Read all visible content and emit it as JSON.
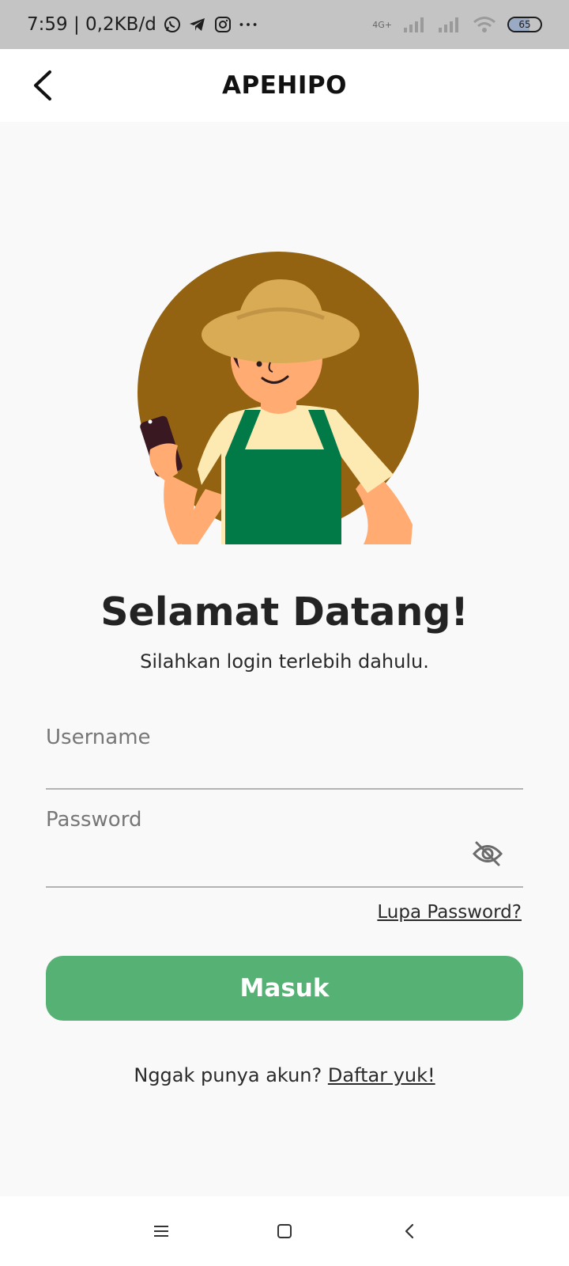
{
  "status_bar": {
    "time_and_speed": "7:59 | 0,2KB/d",
    "network_tag": "4G+",
    "battery": "65",
    "battery_level": 0.65
  },
  "header": {
    "title": "APEHIPO"
  },
  "welcome": {
    "title": "Selamat Datang!",
    "subtitle": "Silahkan login terlebih dahulu."
  },
  "form": {
    "username_placeholder": "Username",
    "password_placeholder": "Password",
    "forgot_label": "Lupa Password?",
    "submit_label": "Masuk"
  },
  "register": {
    "prompt": "Nggak punya akun? ",
    "link_label": "Daftar yuk!"
  },
  "colors": {
    "accent": "#55b274",
    "circle": "#946311",
    "apron": "#027a48",
    "status_bar": "#c4c4c4"
  },
  "icons": [
    "back-arrow-icon",
    "eye-off-icon",
    "whatsapp-icon",
    "telegram-icon",
    "instagram-icon",
    "menu-icon",
    "home-icon",
    "back-icon"
  ]
}
